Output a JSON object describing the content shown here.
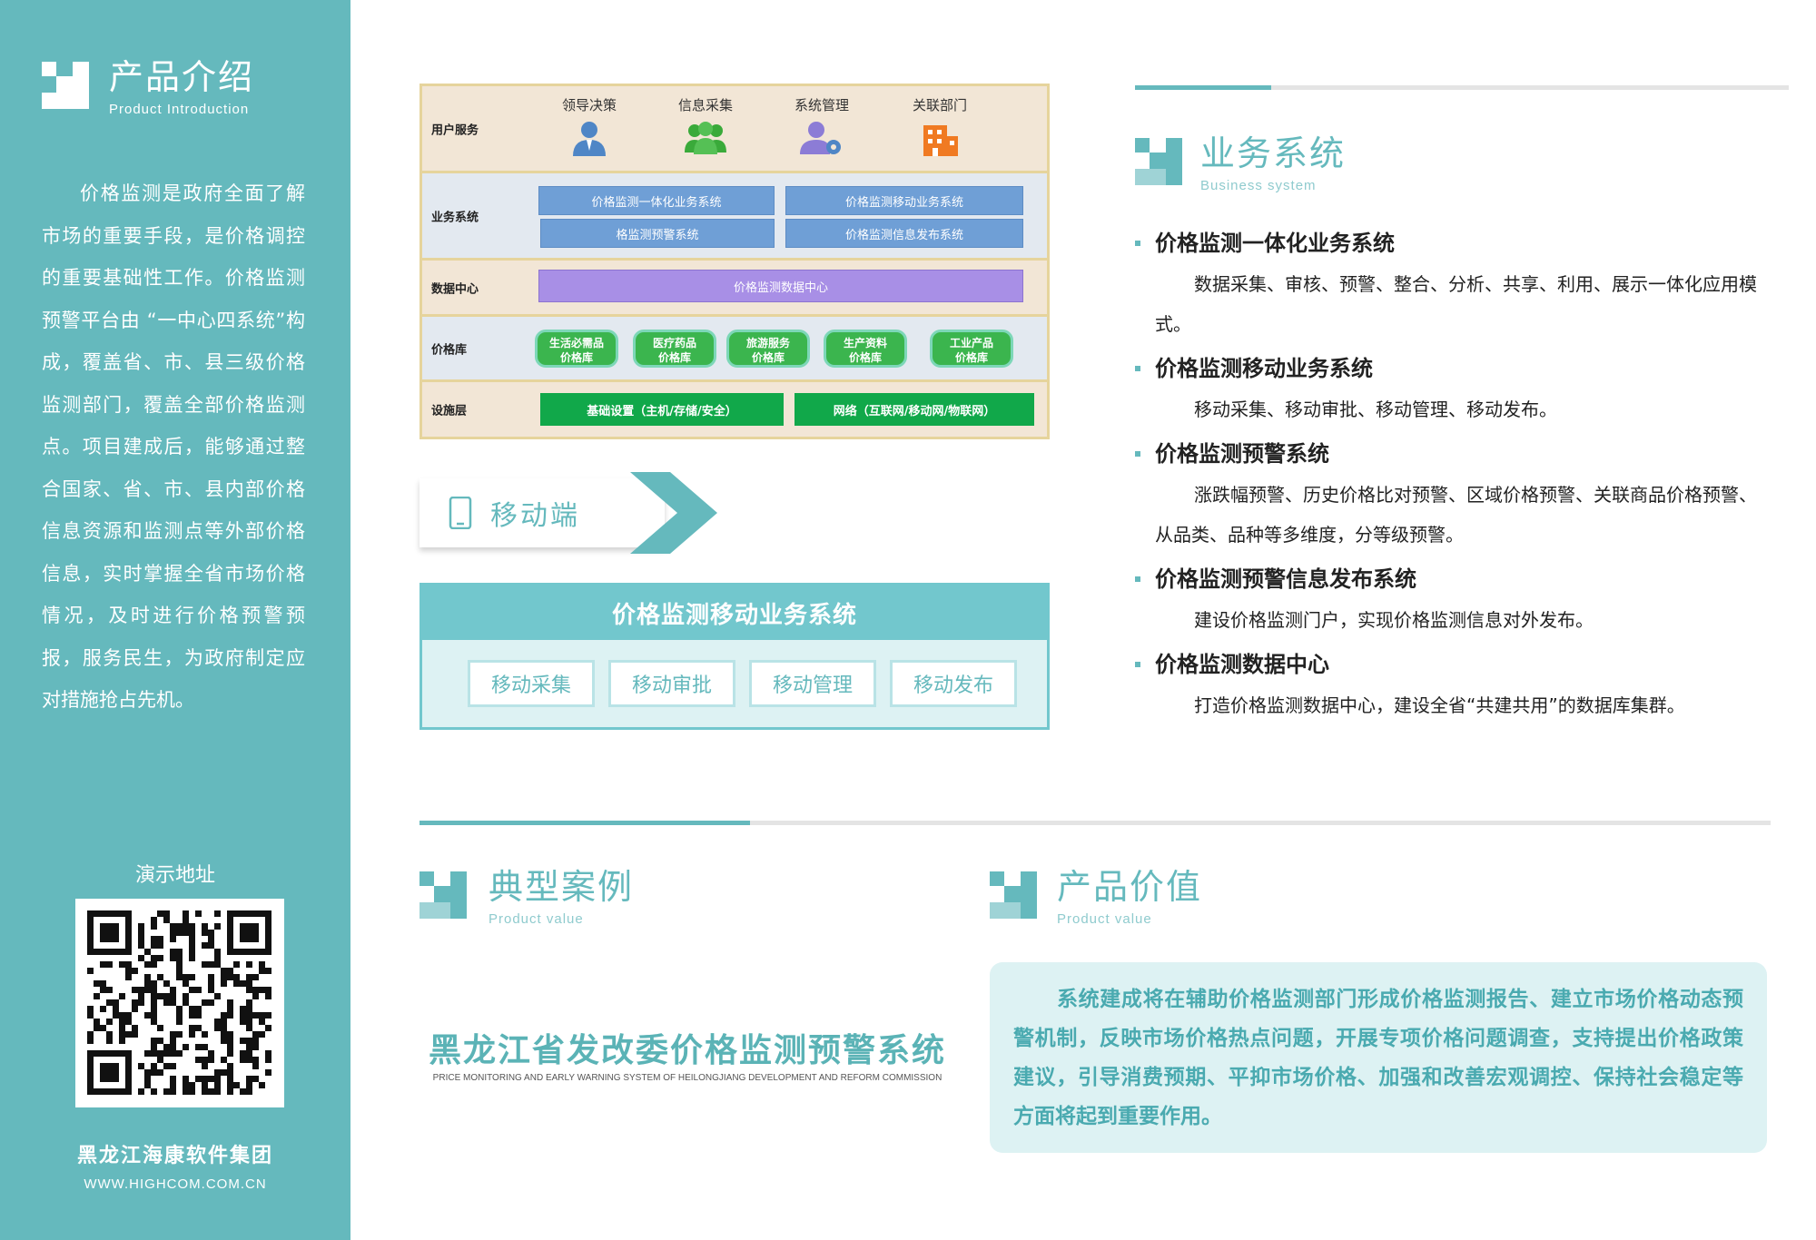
{
  "colors": {
    "teal": "#65b9bd",
    "teal_light": "#72c7cd",
    "teal_pale": "#ddf2f3",
    "blue_btn": "#6f9fd6",
    "purple_bar": "#a88fe6",
    "green_pill": "#3bb54e",
    "green_infra": "#11a84a",
    "orange_icon": "#f07a22"
  },
  "sidebar": {
    "section_title": "产品介绍",
    "section_subtitle": "Product Introduction",
    "intro": "价格监测是政府全面了解市场的重要手段，是价格调控的重要基础性工作。价格监测预警平台由 “一中心四系统”构成，覆盖省、市、县三级价格监测部门，覆盖全部价格监测点。项目建成后，能够通过整合国家、省、市、县内部价格信息资源和监测点等外部价格信息，实时掌握全省市场价格情况，及时进行价格预警预报，服务民生，为政府制定应对措施抢占先机。",
    "demo_label": "演示地址",
    "qr_icon": "qr-code",
    "company": "黑龙江海康软件集团",
    "website": "WWW.HIGHCOM.COM.CN"
  },
  "architecture": {
    "rows": [
      {
        "label": "用户服务"
      },
      {
        "label": "业务系统"
      },
      {
        "label": "数据中心"
      },
      {
        "label": "价格库"
      },
      {
        "label": "设施层"
      }
    ],
    "roles": [
      {
        "label": "领导决策",
        "icon": "person-icon"
      },
      {
        "label": "信息采集",
        "icon": "group-icon"
      },
      {
        "label": "系统管理",
        "icon": "user-gear-icon"
      },
      {
        "label": "关联部门",
        "icon": "building-icon"
      }
    ],
    "systems": [
      "价格监测一体化业务系统",
      "价格监测移动业务系统",
      "格监测预警系统",
      "价格监测信息发布系统"
    ],
    "data_center": "价格监测数据中心",
    "libraries": [
      {
        "line1": "生活必需品",
        "line2": "价格库"
      },
      {
        "line1": "医疗药品",
        "line2": "价格库"
      },
      {
        "line1": "旅游服务",
        "line2": "价格库"
      },
      {
        "line1": "生产资料",
        "line2": "价格库"
      },
      {
        "line1": "工业产品",
        "line2": "价格库"
      }
    ],
    "infrastructure": [
      "基础设置（主机/存储/安全）",
      "网络（互联网/移动网/物联网）"
    ]
  },
  "mobile": {
    "tab_label": "移动端",
    "tab_icon": "phone-icon",
    "system_title": "价格监测移动业务系统",
    "buttons": [
      "移动采集",
      "移动审批",
      "移动管理",
      "移动发布"
    ]
  },
  "business": {
    "section_title": "业务系统",
    "section_subtitle": "Business system",
    "items": [
      {
        "title": "价格监测一体化业务系统",
        "desc": "数据采集、审核、预警、整合、分析、共享、利用、展示一体化应用模式。"
      },
      {
        "title": "价格监测移动业务系统",
        "desc": "移动采集、移动审批、移动管理、移动发布。"
      },
      {
        "title": "价格监测预警系统",
        "desc": "涨跌幅预警、历史价格比对预警、区域价格预警、关联商品价格预警、从品类、品种等多维度，分等级预警。"
      },
      {
        "title": "价格监测预警信息发布系统",
        "desc": "建设价格监测门户，实现价格监测信息对外发布。"
      },
      {
        "title": "价格监测数据中心",
        "desc": "打造价格监测数据中心，建设全省“共建共用”的数据库集群。"
      }
    ]
  },
  "cases": {
    "section_title": "典型案例",
    "section_subtitle": "Product value",
    "case_cn": "黑龙江省发改委价格监测预警系统",
    "case_en": "PRICE MONITORING AND EARLY WARNING SYSTEM OF HEILONGJIANG DEVELOPMENT AND REFORM COMMISSION"
  },
  "value": {
    "section_title": "产品价值",
    "section_subtitle": "Product value",
    "text": "系统建成将在辅助价格监测部门形成价格监测报告、建立市场价格动态预警机制，反映市场价格热点问题，开展专项价格问题调查，支持提出价格政策建议，引导消费预期、平抑市场价格、加强和改善宏观调控、保持社会稳定等方面将起到重要作用。"
  }
}
